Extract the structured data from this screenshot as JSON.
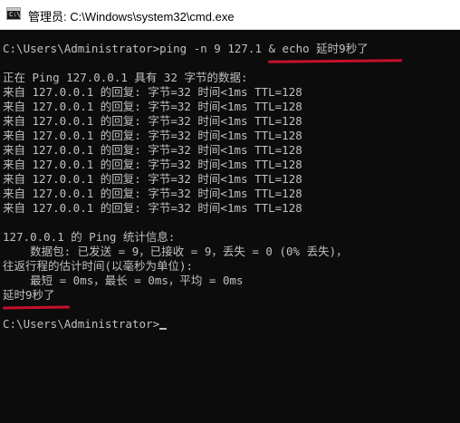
{
  "window": {
    "title": "管理员: C:\\Windows\\system32\\cmd.exe",
    "icon": "cmd-icon",
    "icon_prompt": "C:\\"
  },
  "console": {
    "lines": [
      "C:\\Users\\Administrator>ping -n 9 127.1 & echo 延时9秒了",
      "",
      "正在 Ping 127.0.0.1 具有 32 字节的数据:",
      "来自 127.0.0.1 的回复: 字节=32 时间<1ms TTL=128",
      "来自 127.0.0.1 的回复: 字节=32 时间<1ms TTL=128",
      "来自 127.0.0.1 的回复: 字节=32 时间<1ms TTL=128",
      "来自 127.0.0.1 的回复: 字节=32 时间<1ms TTL=128",
      "来自 127.0.0.1 的回复: 字节=32 时间<1ms TTL=128",
      "来自 127.0.0.1 的回复: 字节=32 时间<1ms TTL=128",
      "来自 127.0.0.1 的回复: 字节=32 时间<1ms TTL=128",
      "来自 127.0.0.1 的回复: 字节=32 时间<1ms TTL=128",
      "来自 127.0.0.1 的回复: 字节=32 时间<1ms TTL=128",
      "",
      "127.0.0.1 的 Ping 统计信息:",
      "    数据包: 已发送 = 9，已接收 = 9，丢失 = 0 (0% 丢失)，",
      "往返行程的估计时间(以毫秒为单位):",
      "    最短 = 0ms，最长 = 0ms，平均 = 0ms",
      "延时9秒了",
      "",
      "C:\\Users\\Administrator>"
    ]
  },
  "colors": {
    "background": "#0c0c0c",
    "text": "#c0c0c0",
    "annotation_underline": "#c8102e"
  }
}
